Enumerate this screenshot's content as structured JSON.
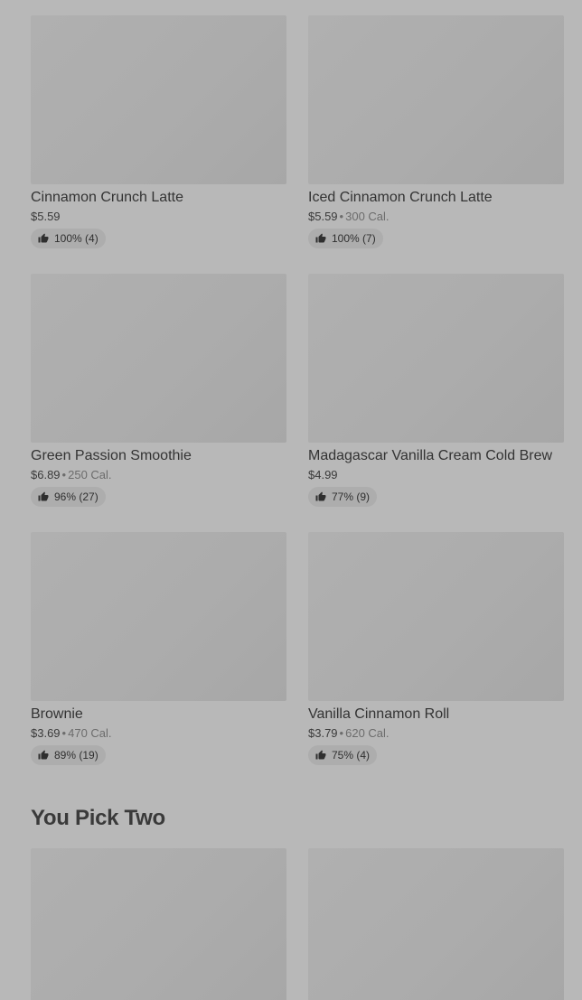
{
  "items": [
    {
      "name": "Cinnamon Crunch Latte",
      "price": "$5.59",
      "calories": "",
      "rating": "100% (4)"
    },
    {
      "name": "Iced Cinnamon Crunch Latte",
      "price": "$5.59",
      "calories": "300 Cal.",
      "rating": "100% (7)"
    },
    {
      "name": "Green Passion Smoothie",
      "price": "$6.89",
      "calories": "250 Cal.",
      "rating": "96% (27)"
    },
    {
      "name": "Madagascar Vanilla Cream Cold Brew",
      "price": "$4.99",
      "calories": "",
      "rating": "77% (9)"
    },
    {
      "name": "Brownie",
      "price": "$3.69",
      "calories": "470 Cal.",
      "rating": "89% (19)"
    },
    {
      "name": "Vanilla Cinnamon Roll",
      "price": "$3.79",
      "calories": "620 Cal.",
      "rating": "75% (4)"
    }
  ],
  "section": {
    "title": "You Pick Two"
  },
  "icons": {
    "rating": "thumbs-up-icon"
  },
  "colors": {
    "background": "#b8b8b8",
    "image_placeholder": "#acacac",
    "rating_pill": "#adadad"
  }
}
